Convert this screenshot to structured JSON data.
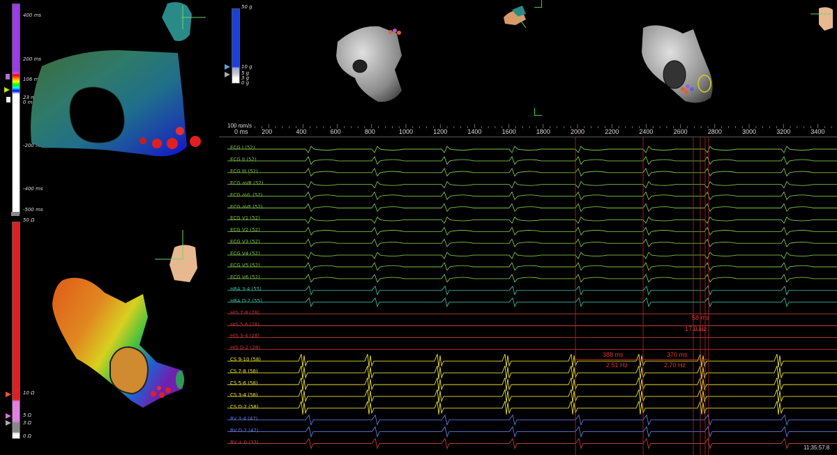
{
  "colors": {
    "background": "#000000",
    "activation_bar": "#8a2be2",
    "voltage_bar": "#e02020",
    "force_bar": "#1c3fd6",
    "ecg_trace": "#7cc444",
    "hra_trace": "#3ab9a0",
    "his_trace": "#c23a3a",
    "cs_trace": "#e8e030",
    "rv_trace": "#6078e0",
    "marker_line": "#c02828",
    "accent_green": "#37d437"
  },
  "lat_scale": {
    "labels": [
      "400 ms",
      "200 ms",
      "106 ms",
      "23 ms",
      "0 ms",
      "-200 ms",
      "-400 ms",
      "-500 ms"
    ]
  },
  "voltage_scale": {
    "labels": [
      "50 Ω",
      "10 Ω",
      "5 Ω",
      "3 Ω",
      "0 Ω"
    ]
  },
  "force_scale": {
    "labels": [
      "50 g",
      "10 g",
      "5 g",
      "3 g",
      "0 g"
    ]
  },
  "timeline": {
    "speed": "100 mm/s",
    "ticks": [
      "0 ms",
      "200",
      "400",
      "600",
      "800",
      "1000",
      "1200",
      "1400",
      "1600",
      "1800",
      "2000",
      "2200",
      "2400",
      "2600",
      "2800",
      "3000",
      "3200",
      "3400"
    ]
  },
  "channels": [
    {
      "label": "ECG I (52)",
      "group": "ecg"
    },
    {
      "label": "ECG II (52)",
      "group": "ecg"
    },
    {
      "label": "ECG III (52)",
      "group": "ecg"
    },
    {
      "label": "ECG aVR (52)",
      "group": "ecg"
    },
    {
      "label": "ECG aVL (52)",
      "group": "ecg"
    },
    {
      "label": "ECG aVF (52)",
      "group": "ecg"
    },
    {
      "label": "ECG V1 (52)",
      "group": "ecg"
    },
    {
      "label": "ECG V2 (52)",
      "group": "ecg"
    },
    {
      "label": "ECG V3 (52)",
      "group": "ecg"
    },
    {
      "label": "ECG V4 (52)",
      "group": "ecg"
    },
    {
      "label": "ECG V5 (52)",
      "group": "ecg"
    },
    {
      "label": "ECG V6 (52)",
      "group": "ecg"
    },
    {
      "label": "HRA 3-4 (55)",
      "group": "hra"
    },
    {
      "label": "HRA D-2 (55)",
      "group": "hra"
    },
    {
      "label": "HIS 7-8 (28)",
      "group": "his"
    },
    {
      "label": "HIS 5-6 (28)",
      "group": "his"
    },
    {
      "label": "HIS 3-4 (28)",
      "group": "his"
    },
    {
      "label": "HIS D-2 (28)",
      "group": "his"
    },
    {
      "label": "CS 9-10 (58)",
      "group": "cs"
    },
    {
      "label": "CS 7-8 (58)",
      "group": "cs"
    },
    {
      "label": "CS 5-6 (58)",
      "group": "cs"
    },
    {
      "label": "CS 3-4 (58)",
      "group": "cs"
    },
    {
      "label": "CS D-2 (58)",
      "group": "cs"
    },
    {
      "label": "RV 3-4 (47)",
      "group": "rv"
    },
    {
      "label": "RV D-2 (47)",
      "group": "rv"
    },
    {
      "label": "RV + 0 (33)",
      "group": "rv2"
    }
  ],
  "measurements": [
    {
      "ms": "388 ms",
      "hz": "2.51 Hz"
    },
    {
      "ms": "370 ms",
      "hz": "2.70 Hz"
    },
    {
      "ms": "58 ms",
      "hz": "17.0 Hz"
    }
  ],
  "clock": "11:35:57.8"
}
